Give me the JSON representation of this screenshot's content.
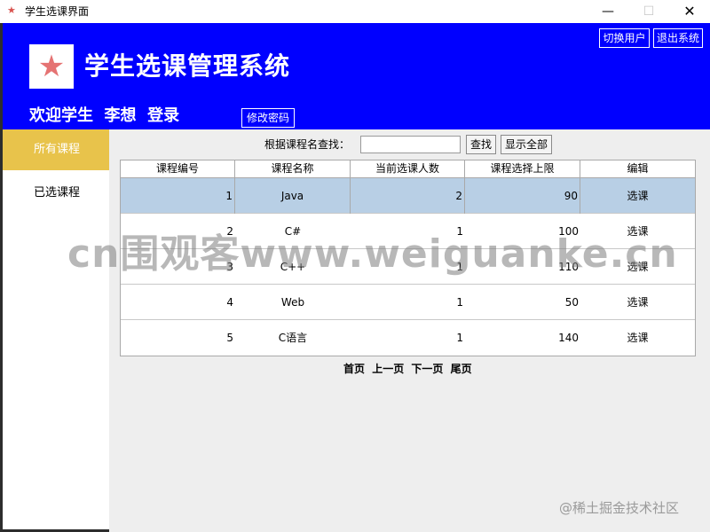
{
  "window": {
    "title": "学生选课界面",
    "minimize_glyph": "—",
    "maximize_glyph": "☐",
    "close_glyph": "✕",
    "app_icon": "star-icon"
  },
  "header": {
    "system_title": "学生选课管理系统",
    "welcome": "欢迎学生  李想  登录",
    "switch_user": "切换用户",
    "exit_system": "退出系统",
    "change_password": "修改密码",
    "logo_icon": "star-icon",
    "background_color": "#0000ff"
  },
  "sidebar": {
    "items": [
      {
        "label": "所有课程",
        "active": true
      },
      {
        "label": "已选课程",
        "active": false
      }
    ],
    "active_color": "#e8c34b"
  },
  "search": {
    "label": "根据课程名查找：",
    "value": "",
    "find_button": "查找",
    "show_all_button": "显示全部"
  },
  "table": {
    "headers": [
      "课程编号",
      "课程名称",
      "当前选课人数",
      "课程选择上限",
      "编辑"
    ],
    "rows": [
      {
        "id": "1",
        "name": "Java",
        "current": "2",
        "limit": "90",
        "action": "选课"
      },
      {
        "id": "2",
        "name": "C#",
        "current": "1",
        "limit": "100",
        "action": "选课"
      },
      {
        "id": "3",
        "name": "C++",
        "current": "1",
        "limit": "110",
        "action": "选课"
      },
      {
        "id": "4",
        "name": "Web",
        "current": "1",
        "limit": "50",
        "action": "选课"
      },
      {
        "id": "5",
        "name": "C语言",
        "current": "1",
        "limit": "140",
        "action": "选课"
      }
    ],
    "selected_row_color": "#b8cfe5"
  },
  "pager": {
    "first": "首页",
    "prev": "上一页",
    "next": "下一页",
    "last": "尾页"
  },
  "watermark": {
    "center": "cn围观客www.weiguanke.cn",
    "corner": "@稀土掘金技术社区"
  }
}
